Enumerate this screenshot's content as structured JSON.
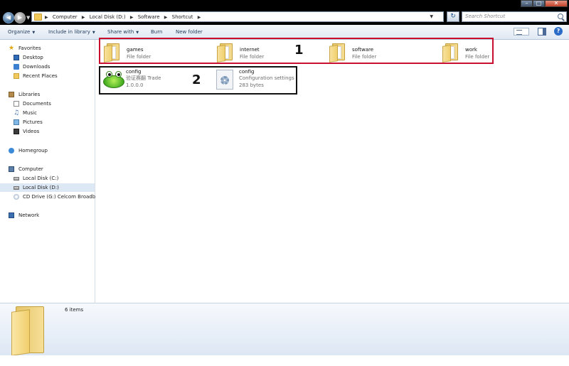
{
  "window": {
    "address_path": [
      "Computer",
      "Local Disk (D:)",
      "Software",
      "Shortcut"
    ],
    "search_placeholder": "Search Shortcut"
  },
  "toolbar": {
    "organize": "Organize",
    "include_in_library": "Include in library",
    "share_with": "Share with",
    "burn": "Burn",
    "new_folder": "New folder"
  },
  "nav": {
    "favorites": "Favorites",
    "desktop": "Desktop",
    "downloads": "Downloads",
    "recent_places": "Recent Places",
    "libraries": "Libraries",
    "documents": "Documents",
    "music": "Music",
    "pictures": "Pictures",
    "videos": "Videos",
    "homegroup": "Homegroup",
    "computer": "Computer",
    "local_disk_c": "Local Disk (C:)",
    "local_disk_d": "Local Disk (D:)",
    "cd_drive": "CD Drive (G:) Celcom Broadba",
    "network": "Network"
  },
  "folders": [
    {
      "name": "games",
      "type": "File folder"
    },
    {
      "name": "internet",
      "type": "File folder"
    },
    {
      "name": "software",
      "type": "File folder"
    },
    {
      "name": "work",
      "type": "File folder"
    }
  ],
  "files": [
    {
      "name": "config",
      "line2": "验证赛翻 Trade",
      "line3": "1.0.0.0"
    },
    {
      "name": "config",
      "line2": "Configuration settings",
      "line3": "283 bytes"
    }
  ],
  "annotations": {
    "label_1": "1",
    "label_2": "2"
  },
  "details": {
    "items_count": "6 items"
  },
  "colors": {
    "annotation_red": "#c8102e",
    "annotation_black": "#111111",
    "folder_yellow": "#f0cf6c"
  }
}
